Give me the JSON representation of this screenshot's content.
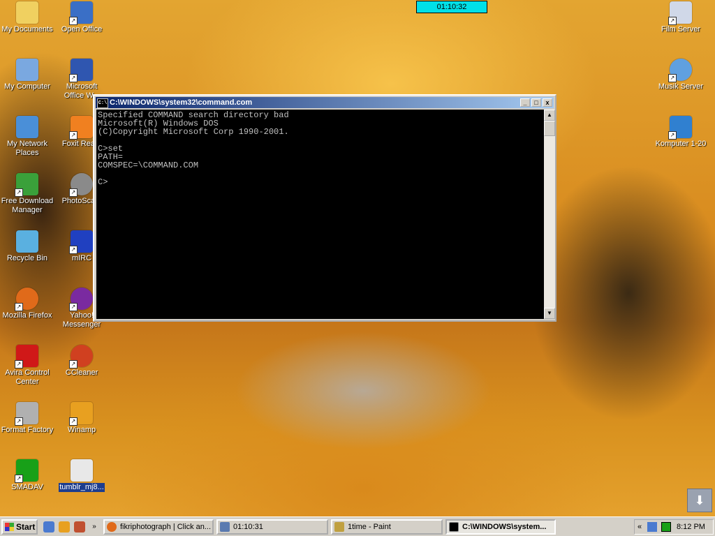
{
  "clock_widget": "01:10:32",
  "desktop_icons": [
    {
      "label": "My Documents",
      "icon": "documents-folder-icon",
      "color": "#f0d060"
    },
    {
      "label": "Open Office",
      "icon": "openoffice-icon",
      "color": "#3a6fc6"
    },
    {
      "label": "My Computer",
      "icon": "computer-icon",
      "color": "#7aa8e0"
    },
    {
      "label": "Microsoft Office W...",
      "icon": "word-icon",
      "color": "#2f56b0"
    },
    {
      "label": "My Network Places",
      "icon": "network-icon",
      "color": "#4a8fd8"
    },
    {
      "label": "Foxit Rea...",
      "icon": "foxit-icon",
      "color": "#f08020"
    },
    {
      "label": "Free Download Manager",
      "icon": "download-manager-icon",
      "color": "#3aa03a"
    },
    {
      "label": "PhotoSca...",
      "icon": "photoscape-icon",
      "color": "#8a8a8a"
    },
    {
      "label": "Recycle Bin",
      "icon": "recycle-bin-icon",
      "color": "#5ab0e0"
    },
    {
      "label": "mIRC",
      "icon": "mirc-icon",
      "color": "#2040c0"
    },
    {
      "label": "Mozilla Firefox",
      "icon": "firefox-icon",
      "color": "#e06a1a"
    },
    {
      "label": "Yahoo! Messenger",
      "icon": "yahoo-messenger-icon",
      "color": "#7a2aa0"
    },
    {
      "label": "Avira Control Center",
      "icon": "avira-icon",
      "color": "#d01818"
    },
    {
      "label": "CCleaner",
      "icon": "ccleaner-icon",
      "color": "#d04020"
    },
    {
      "label": "Format Factory",
      "icon": "format-factory-icon",
      "color": "#b0b0b0"
    },
    {
      "label": "Winamp",
      "icon": "winamp-icon",
      "color": "#e8a020"
    },
    {
      "label": "SMADAV",
      "icon": "smadav-icon",
      "color": "#18a018"
    },
    {
      "label": "tumblr_mj8...",
      "icon": "image-file-icon",
      "color": "#e8e8e8"
    },
    {
      "label": "Film Server",
      "icon": "film-server-icon",
      "color": "#d0d8e8"
    },
    {
      "label": "Musik Server",
      "icon": "music-server-icon",
      "color": "#60a0e0"
    },
    {
      "label": "Komputer 1-20",
      "icon": "computers-network-icon",
      "color": "#3080d0"
    }
  ],
  "cmd_window": {
    "title": "C:\\WINDOWS\\system32\\command.com",
    "title_icon": "C:\\",
    "minimize": "_",
    "maximize": "□",
    "close": "x",
    "lines": [
      "Specified COMMAND search directory bad",
      "Microsoft(R) Windows DOS",
      "(C)Copyright Microsoft Corp 1990-2001.",
      "",
      "C>set",
      "PATH=",
      "COMSPEC=\\COMMAND.COM",
      "",
      "C>"
    ]
  },
  "taskbar": {
    "start_label": "Start",
    "more_arrow": "»",
    "buttons": [
      {
        "label": "fikriphotograph | Click an...",
        "icon": "firefox-icon",
        "color": "#e06a1a",
        "active": false
      },
      {
        "label": "01:10:31",
        "icon": "clock-app-icon",
        "color": "#5a7ab0",
        "active": false
      },
      {
        "label": "1time - Paint",
        "icon": "paint-icon",
        "color": "#c0a040",
        "active": false
      },
      {
        "label": "C:\\WINDOWS\\system...",
        "icon": "command-prompt-icon",
        "color": "#000000",
        "active": true
      }
    ],
    "tray_chevron": "«",
    "time": "8:12 PM"
  }
}
